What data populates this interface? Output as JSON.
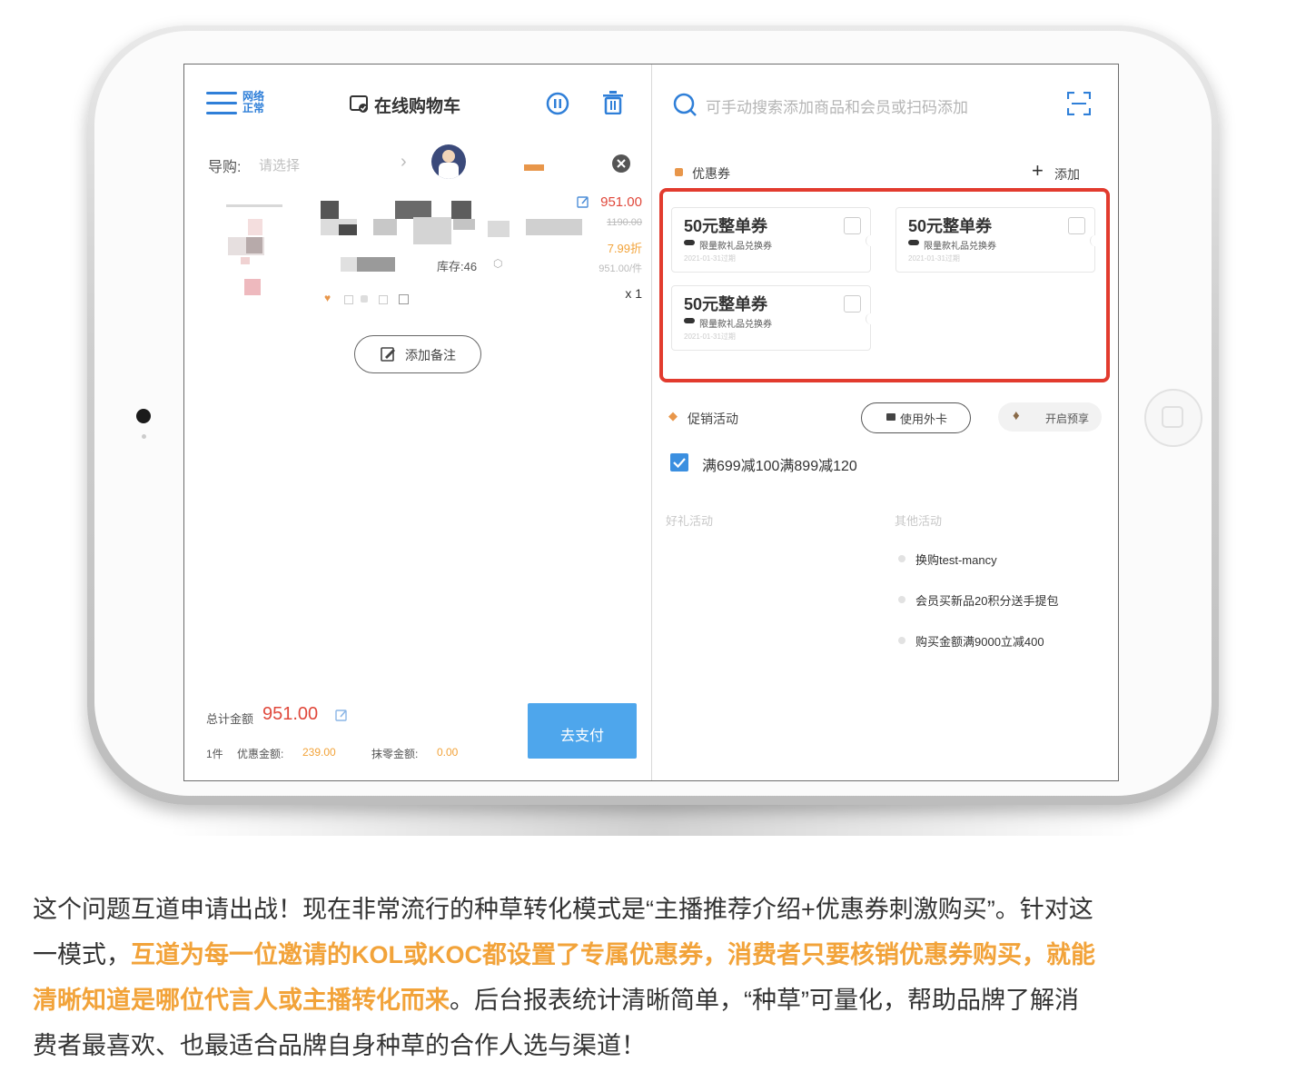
{
  "left_panel": {
    "network_label": "网络正常",
    "cart_title": "在线购物车",
    "guide_label": "导购:",
    "guide_placeholder": "请选择",
    "product": {
      "price": "951.00",
      "original_price": "1190.00",
      "discount": "7.99折",
      "unit_price": "951.00/件",
      "stock": "库存:46",
      "quantity": "x 1"
    },
    "add_note_label": "添加备注",
    "total_label": "总计金额",
    "total_value": "951.00",
    "count_label": "1件",
    "discount_amount_label": "优惠金额:",
    "discount_amount_value": "239.00",
    "rounding_label": "抹零金额:",
    "rounding_value": "0.00",
    "pay_button": "去支付"
  },
  "right_panel": {
    "search_placeholder": "可手动搜索添加商品和会员或扫码添加",
    "coupons_label": "优惠券",
    "add_label": "添加",
    "coupons": [
      {
        "title": "50元整单券",
        "subtitle": "限量款礼品兑换券",
        "date": "2021-01-31过期"
      },
      {
        "title": "50元整单券",
        "subtitle": "限量款礼品兑换券",
        "date": "2021-01-31过期"
      },
      {
        "title": "50元整单券",
        "subtitle": "限量款礼品兑换券",
        "date": "2021-01-31过期"
      }
    ],
    "promo_label": "促销活动",
    "external_card_button": "使用外卡",
    "presale_button": "开启预享",
    "promo_option": "满699减100满899减120",
    "gift_activity_label": "好礼活动",
    "other_activity_label": "其他活动",
    "other_activities": [
      "换购test-mancy",
      "会员买新品20积分送手提包",
      "购买金额满9000立减400"
    ]
  },
  "article": {
    "line1": "这个问题互道申请出战！现在非常流行的种草转化模式是“主播推荐介绍+优惠券刺激购买”。针对这",
    "line2_a": "一模式，",
    "line2_b": "互道为每一位邀请的KOL或KOC都设置了专属优惠券，消费者只要核销优惠券购买，就能",
    "line3_a": "清晰知道是哪位代言人或主播转化而来",
    "line3_b": "。后台报表统计清晰简单，“种草”可量化，帮助品牌了解消",
    "line4": "费者最喜欢、也最适合品牌自身种草的合作人选与渠道！"
  },
  "colors": {
    "accent_blue": "#2f7fd8",
    "price_red": "#e0483b",
    "highlight_orange": "#f2a33a",
    "pay_blue": "#4ea6ec"
  }
}
